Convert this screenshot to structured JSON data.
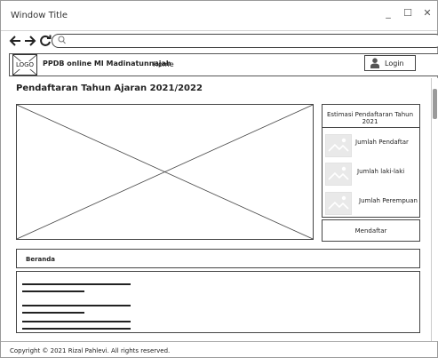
{
  "window": {
    "title": "Window Title",
    "minimize": "_",
    "maximize": "☐",
    "close": "✕"
  },
  "browser": {
    "back": "🡐",
    "forward": "🡒",
    "reload": "↻",
    "url_value": "",
    "search_glyph": "⚲"
  },
  "header": {
    "logo": "LOGO",
    "site_name": "PPDB online MI Madinatunnajah",
    "nav_home": "Home",
    "login_label": "Login"
  },
  "page": {
    "title": "Pendaftaran Tahun Ajaran 2021/2022"
  },
  "estimasi": {
    "title": "Estimasi Pendaftaran Tahun 2021",
    "items": [
      {
        "label": "Jumlah Pendaftar",
        "icon": "image-placeholder-icon"
      },
      {
        "label": "Jumlah laki-laki",
        "icon": "image-placeholder-icon"
      },
      {
        "label": "Jumlah Perempuan",
        "icon": "image-placeholder-icon"
      }
    ]
  },
  "actions": {
    "register_label": "Mendaftar"
  },
  "section": {
    "beranda_label": "Beranda"
  },
  "footer": {
    "copyright": "Copyright © 2021 Rizal Pahlevi. All rights reserved."
  }
}
